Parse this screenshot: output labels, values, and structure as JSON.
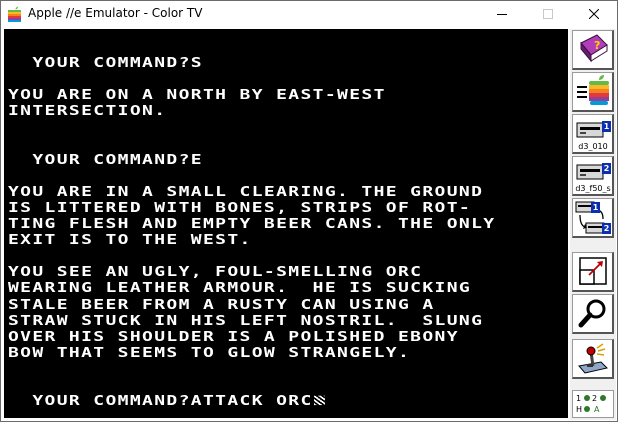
{
  "window": {
    "title": "Apple //e Emulator - Color TV"
  },
  "screen": {
    "lines": [
      "  YOUR COMMAND?S",
      "",
      "YOU ARE ON A NORTH BY EAST-WEST",
      "INTERSECTION.",
      "",
      "",
      "  YOUR COMMAND?E",
      "",
      "YOU ARE IN A SMALL CLEARING. THE GROUND",
      "IS LITTERED WITH BONES, STRIPS OF ROT-",
      "TING FLESH AND EMPTY BEER CANS. THE ONLY",
      "EXIT IS TO THE WEST.",
      "",
      "YOU SEE AN UGLY, FOUL-SMELLING ORC",
      "WEARING LEATHER ARMOUR.  HE IS SUCKING",
      "STALE BEER FROM A RUSTY CAN USING A",
      "STRAW STUCK IN HIS LEFT NOSTRIL.  SLUNG",
      "OVER HIS SHOULDER IS A POLISHED EBONY",
      "BOW THAT SEEMS TO GLOW STRANGELY.",
      "",
      "",
      "  YOUR COMMAND?ATTACK ORC"
    ]
  },
  "toolbar": {
    "drive1_number": "1",
    "drive1_label": "d3_010",
    "drive2_number": "2",
    "drive2_label": "d3_f50_s",
    "swap_num1": "1",
    "swap_num2": "2",
    "status": {
      "row1_a": "1",
      "row1_b": "2",
      "row2_a": "H",
      "row2_b": "A"
    }
  },
  "colors": {
    "screen_bg": "#000000",
    "screen_text": "#ffffff",
    "drive_badge": "#0b2fb0",
    "led": "#2a7a2a"
  },
  "icons": {
    "app": "apple-logo-icon",
    "help": "help-book-icon",
    "settings": "apple-menu-icon",
    "drive1": "floppy-drive-icon",
    "drive2": "floppy-drive-icon",
    "swap": "swap-drives-icon",
    "fullscreen": "fullscreen-icon",
    "debugger": "magnifier-icon",
    "joystick": "joystick-icon"
  }
}
